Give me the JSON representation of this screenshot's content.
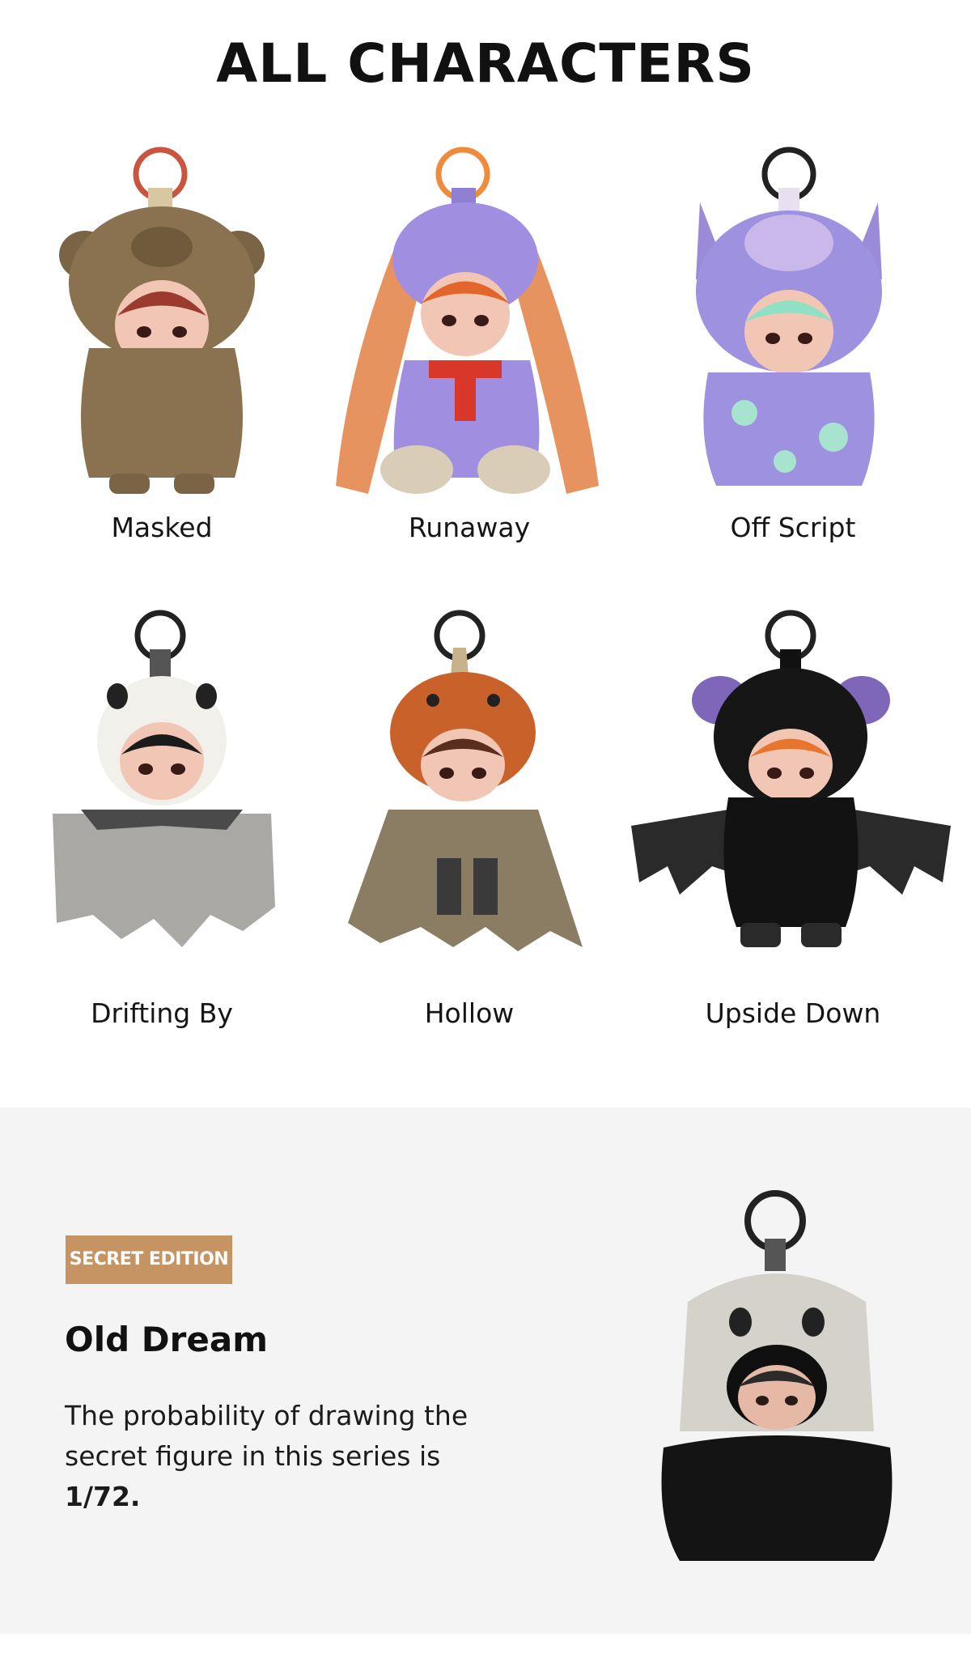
{
  "page": {
    "title": "ALL CHARACTERS"
  },
  "characters": [
    {
      "name": "Masked",
      "icon": "brown-bear-figure-icon"
    },
    {
      "name": "Runaway",
      "icon": "purple-bunny-figure-icon"
    },
    {
      "name": "Off Script",
      "icon": "lavender-monster-figure-icon"
    },
    {
      "name": "Drifting By",
      "icon": "panda-ghost-figure-icon"
    },
    {
      "name": "Hollow",
      "icon": "pumpkin-cloak-figure-icon"
    },
    {
      "name": "Upside Down",
      "icon": "black-bat-figure-icon"
    }
  ],
  "secret": {
    "badge": "SECRET EDITION",
    "name": "Old Dream",
    "desc_text": "The probability of drawing the secret figure in this series is",
    "probability": "1/72.",
    "icon": "ghost-hood-figure-icon"
  },
  "colors": {
    "badge_bg": "#c69463",
    "section_bg": "#f4f4f4",
    "text": "#111111"
  }
}
